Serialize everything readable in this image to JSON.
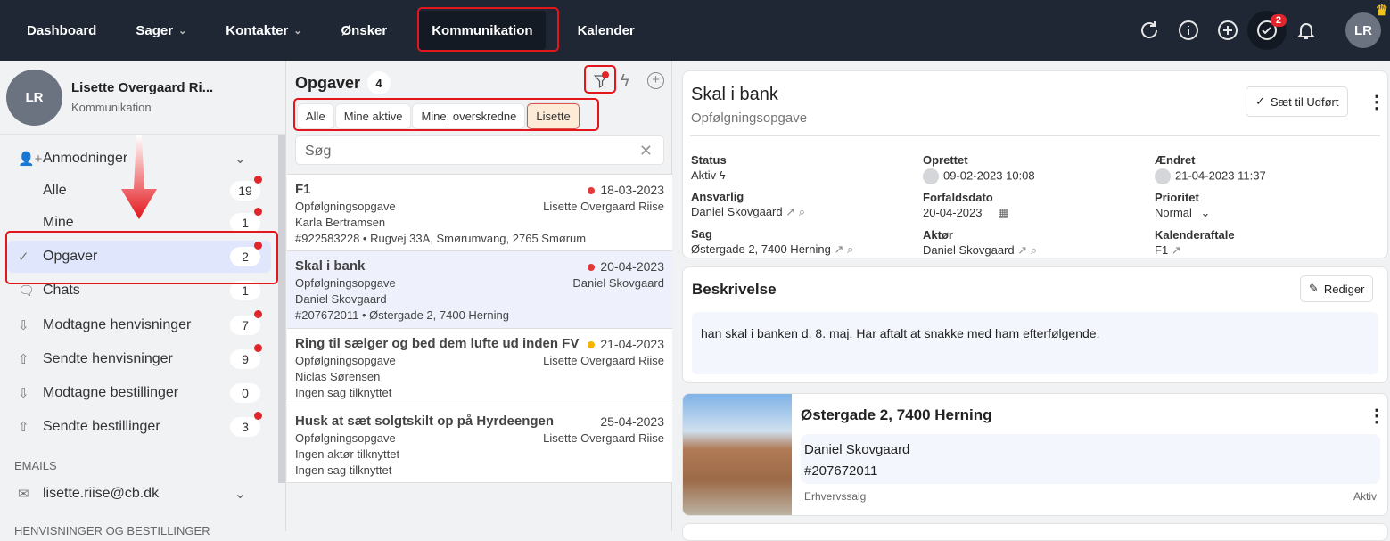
{
  "nav": {
    "items": [
      {
        "label": "Dashboard"
      },
      {
        "label": "Sager"
      },
      {
        "label": "Kontakter"
      },
      {
        "label": "Ønsker"
      },
      {
        "label": "Kommunikation"
      },
      {
        "label": "Kalender"
      }
    ],
    "tasks_badge": "2",
    "avatar": "LR"
  },
  "profile": {
    "initials": "LR",
    "name": "Lisette Overgaard Ri...",
    "sub": "Kommunikation"
  },
  "sidebar": {
    "group": "Anmodninger",
    "items": [
      {
        "label": "Alle",
        "count": "19"
      },
      {
        "label": "Mine",
        "count": "1"
      },
      {
        "label": "Opgaver",
        "count": "2"
      },
      {
        "label": "Chats",
        "count": "1"
      },
      {
        "label": "Modtagne henvisninger",
        "count": "7"
      },
      {
        "label": "Sendte henvisninger",
        "count": "9"
      },
      {
        "label": "Modtagne bestillinger",
        "count": "0"
      },
      {
        "label": "Sendte bestillinger",
        "count": "3"
      }
    ],
    "emails_header": "EMAILS",
    "email": "lisette.riise@cb.dk",
    "section2": "HENVISNINGER OG BESTILLINGER"
  },
  "list": {
    "title": "Opgaver",
    "count": "4",
    "filters": [
      "Alle",
      "Mine aktive",
      "Mine, overskredne",
      "Lisette"
    ],
    "search_placeholder": "Søg",
    "tasks": [
      {
        "title": "F1",
        "date": "18-03-2023",
        "dot": "#e5383b",
        "type": "Opfølgningsopgave",
        "owner": "Lisette Overgaard Riise",
        "contact": "Karla Bertramsen",
        "case": "#922583228 • Rugvej 33A, Smørumvang, 2765 Smørum"
      },
      {
        "title": "Skal i bank",
        "date": "20-04-2023",
        "dot": "#e5383b",
        "type": "Opfølgningsopgave",
        "owner": "Daniel Skovgaard",
        "contact": "Daniel Skovgaard",
        "case": "#207672011 • Østergade 2, 7400 Herning"
      },
      {
        "title": "Ring til sælger og bed dem lufte ud inden FV",
        "date": "21-04-2023",
        "dot": "#f5b400",
        "type": "Opfølgningsopgave",
        "owner": "Lisette Overgaard Riise",
        "contact": "Niclas Sørensen",
        "case": "Ingen sag tilknyttet"
      },
      {
        "title": "Husk at sæt solgtskilt op på Hyrdeengen",
        "date": "25-04-2023",
        "dot": "",
        "type": "Opfølgningsopgave",
        "owner": "Lisette Overgaard Riise",
        "contact": "Ingen aktør tilknyttet",
        "case": "Ingen sag tilknyttet"
      }
    ]
  },
  "detail": {
    "title": "Skal i bank",
    "subtitle": "Opfølgningsopgave",
    "done_button": "Sæt til Udført",
    "fields": {
      "status_label": "Status",
      "status": "Aktiv",
      "created_label": "Oprettet",
      "created": "09-02-2023 10:08",
      "changed_label": "Ændret",
      "changed": "21-04-2023 11:37",
      "resp_label": "Ansvarlig",
      "resp": "Daniel Skovgaard",
      "due_label": "Forfaldsdato",
      "due": "20-04-2023",
      "prio_label": "Prioritet",
      "prio": "Normal",
      "case_label": "Sag",
      "case": "Østergade 2, 7400 Herning",
      "actor_label": "Aktør",
      "actor": "Daniel Skovgaard",
      "cal_label": "Kalenderaftale",
      "cal": "F1"
    },
    "desc_title": "Beskrivelse",
    "edit_button": "Rediger",
    "desc": "han skal i banken d. 8. maj. Har aftalt at snakke med ham efterfølgende."
  },
  "property": {
    "address": "Østergade 2, 7400 Herning",
    "contact": "Daniel Skovgaard",
    "case_no": "#207672011",
    "type": "Erhvervssalg",
    "status": "Aktiv"
  }
}
